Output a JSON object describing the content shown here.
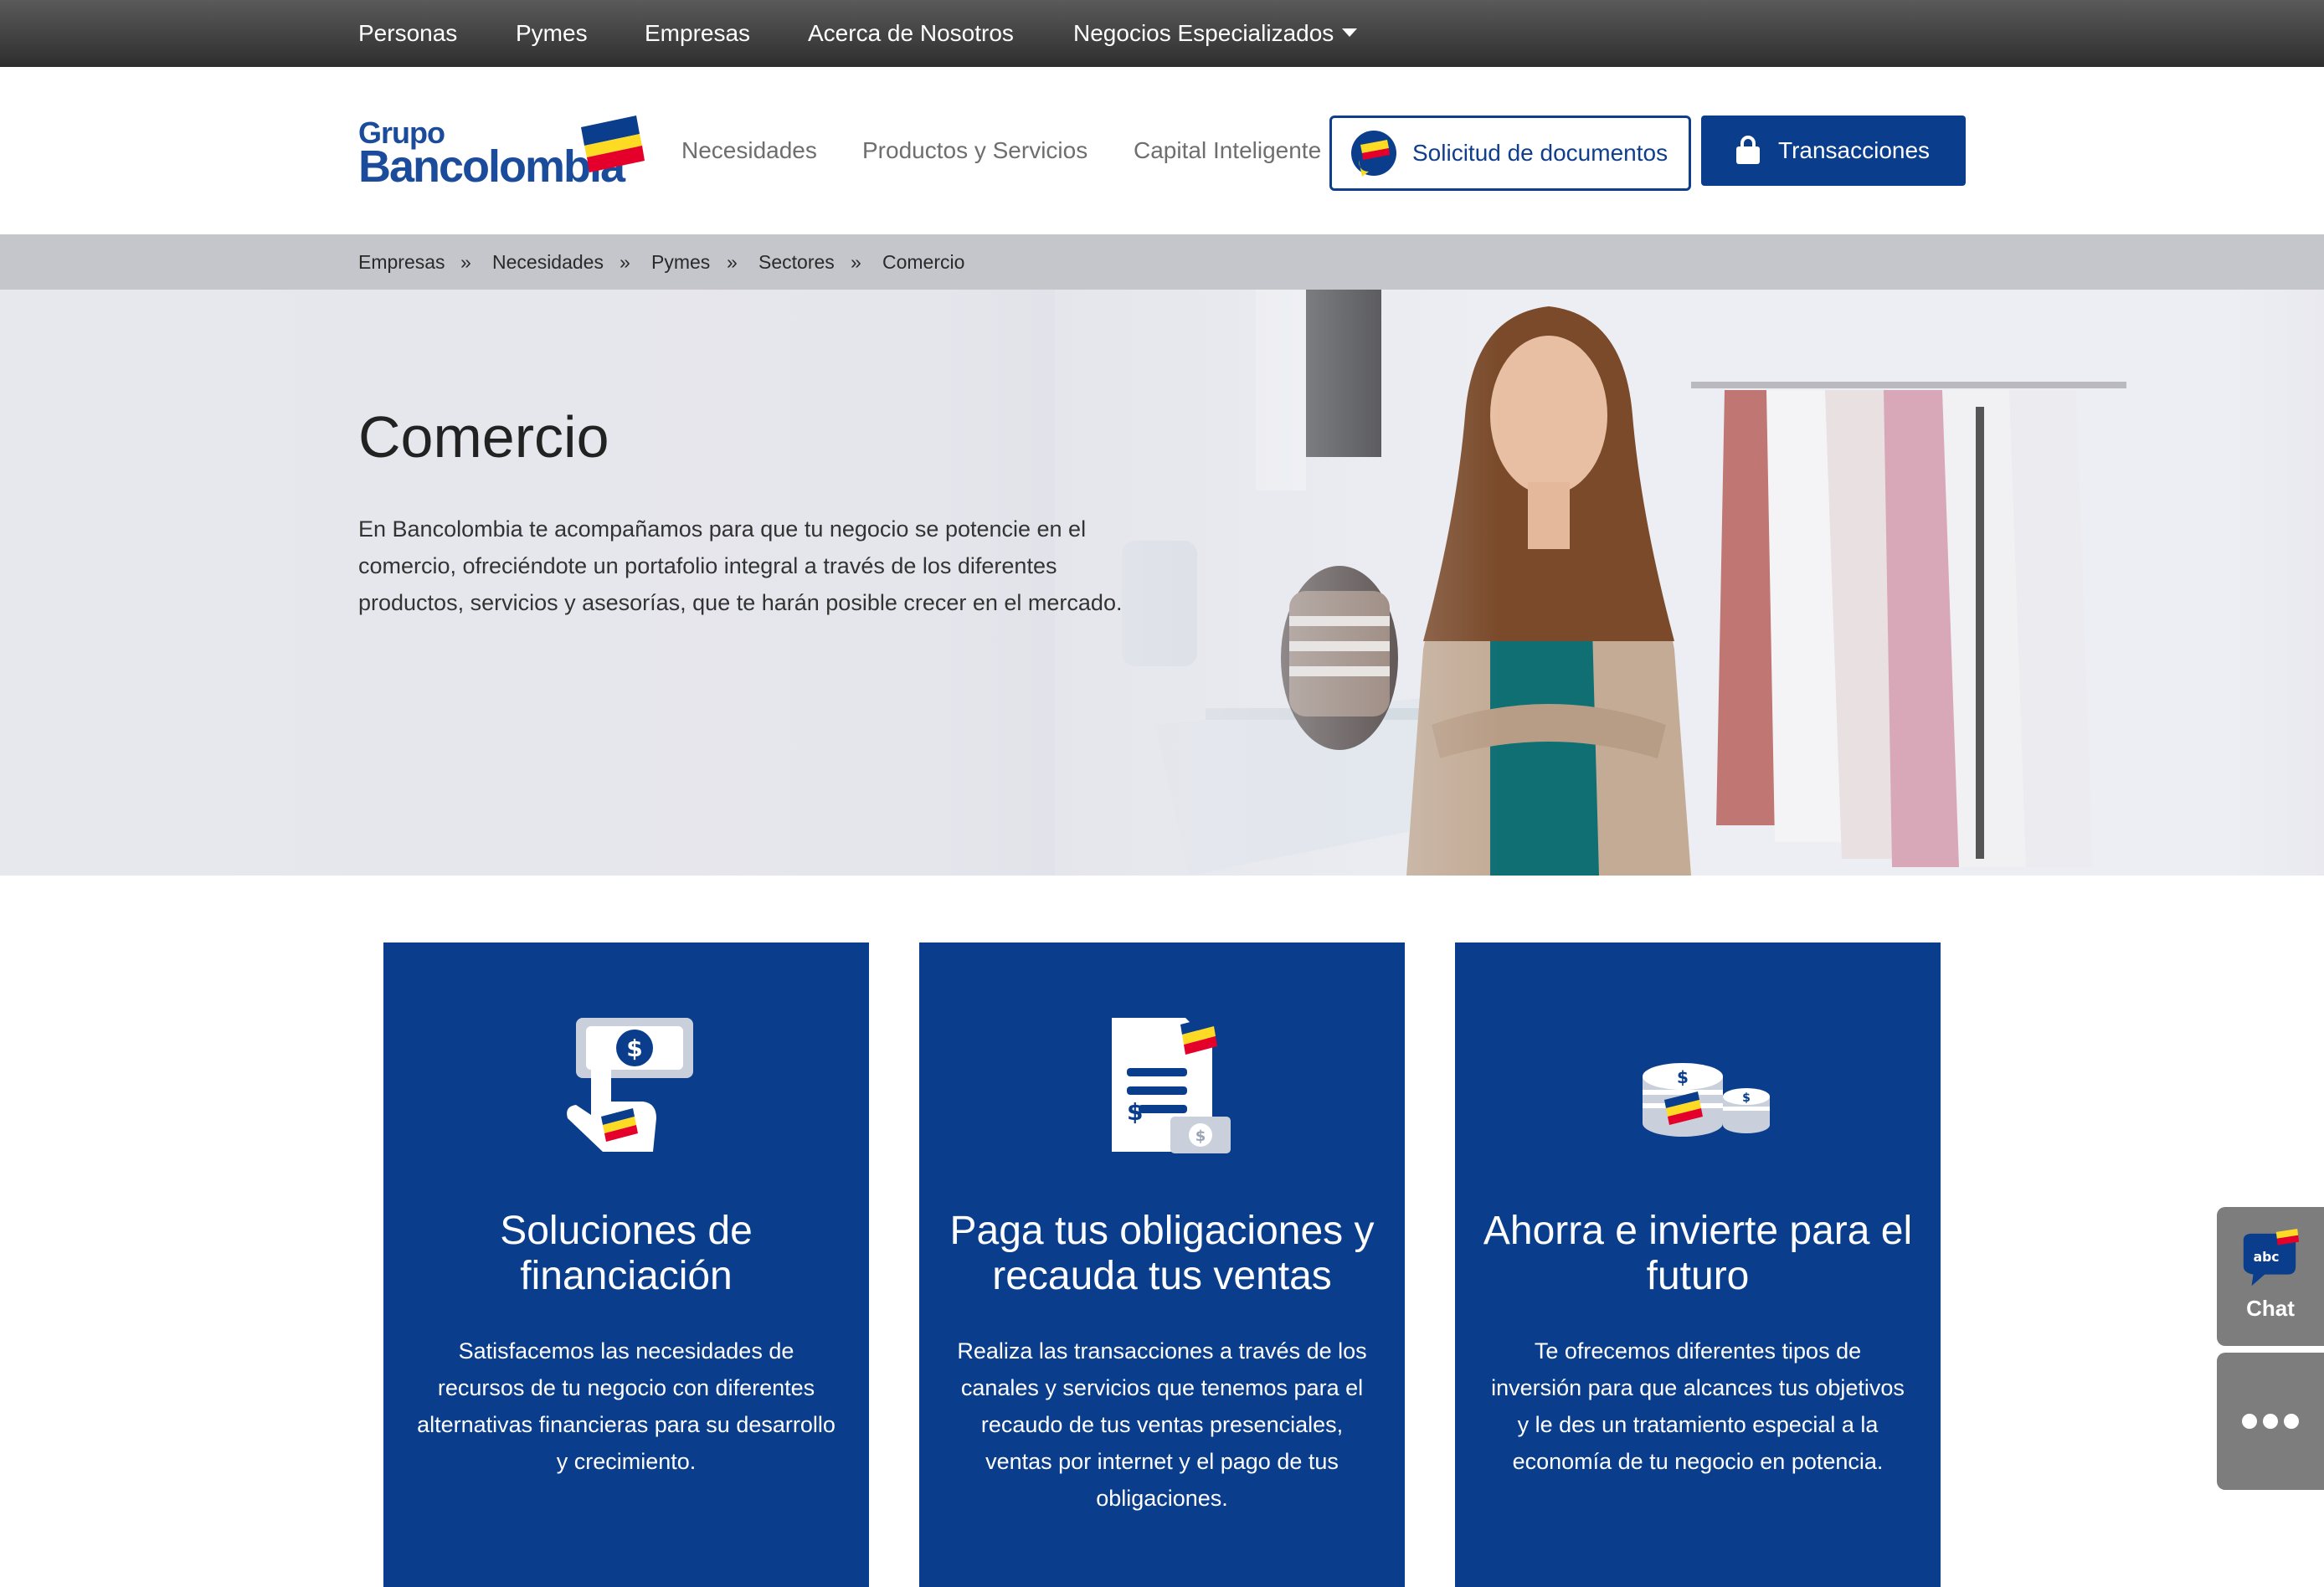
{
  "topbar": {
    "items": [
      "Personas",
      "Pymes",
      "Empresas",
      "Acerca de Nosotros",
      "Negocios Especializados"
    ]
  },
  "header": {
    "logo": {
      "line1": "Grupo",
      "line2": "Bancolombia"
    },
    "nav": [
      "Necesidades",
      "Productos y Servicios",
      "Capital Inteligente"
    ],
    "docs_button": "Solicitud de documentos",
    "transactions_button": "Transacciones"
  },
  "breadcrumb": {
    "items": [
      "Empresas",
      "Necesidades",
      "Pymes",
      "Sectores",
      "Comercio"
    ],
    "separator": "»"
  },
  "hero": {
    "title": "Comercio",
    "description": "En Bancolombia te acompañamos para que tu negocio se potencie en el comercio, ofreciéndote un portafolio integral a través de los diferentes productos, servicios y asesorías, que te harán posible crecer en el mercado."
  },
  "cards": [
    {
      "icon": "hand-money-icon",
      "title": "Soluciones de financiación",
      "text": "Satisfacemos las necesidades de recursos de tu negocio con diferentes alternativas financieras para su desarrollo y crecimiento."
    },
    {
      "icon": "invoice-icon",
      "title": "Paga tus obligaciones y recauda tus ventas",
      "text": "Realiza las transacciones a través de los canales y servicios que tenemos para el recaudo de tus ventas presenciales, ventas por internet y el pago de tus obligaciones."
    },
    {
      "icon": "coins-icon",
      "title": "Ahorra e invierte para el futuro",
      "text": "Te ofrecemos diferentes tipos de inversión para que alcances tus objetivos y le des un tratamiento especial a la economía de tu negocio en potencia."
    }
  ],
  "side": {
    "chat_badge": "abc",
    "chat_label": "Chat"
  },
  "colors": {
    "brand_blue": "#0a3e8c",
    "brand_yellow": "#fdda24",
    "brand_red": "#e4002b"
  }
}
